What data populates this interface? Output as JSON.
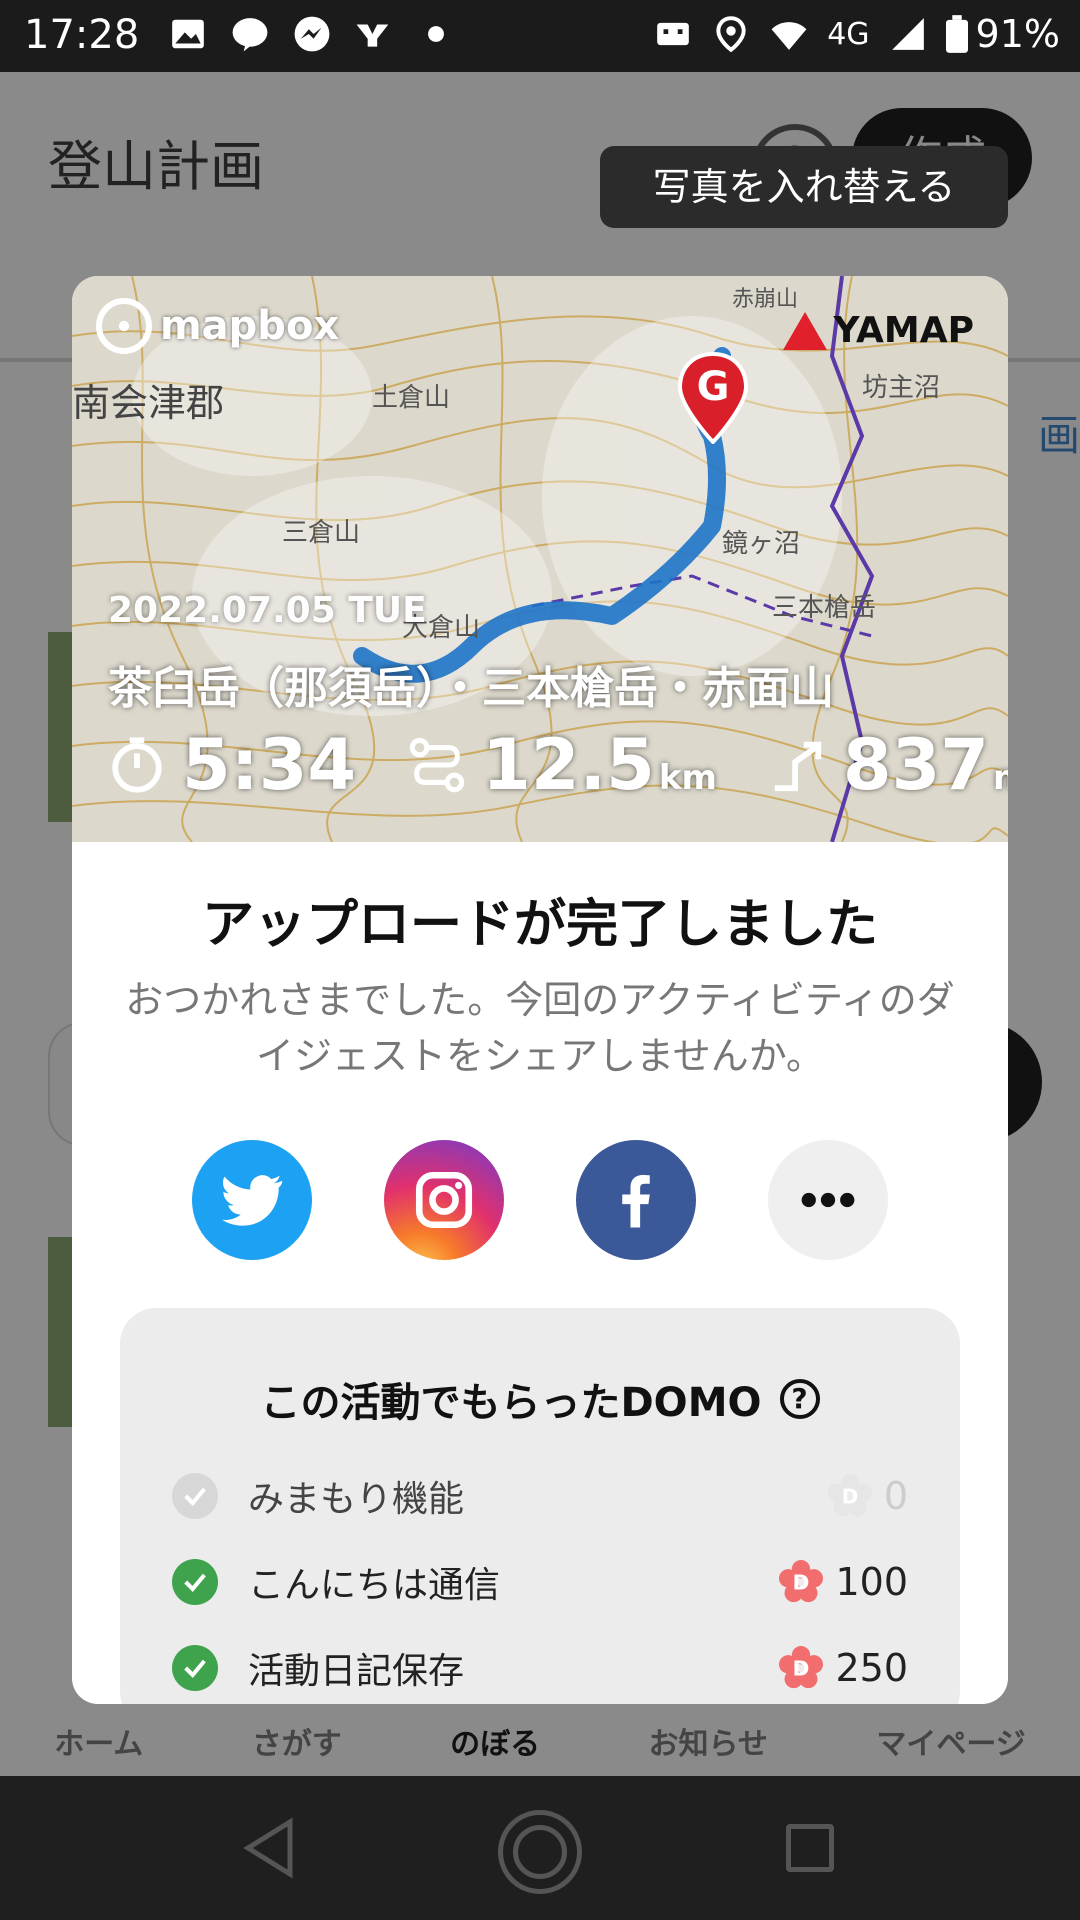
{
  "status": {
    "time": "17:28",
    "network": "4G",
    "battery": "91%"
  },
  "app": {
    "title": "登山計画",
    "create_label": "作成",
    "help_label": "?",
    "edge_text": "画",
    "snackbar": "写真を入れ替える"
  },
  "tabs": [
    {
      "label": "ホーム"
    },
    {
      "label": "さがす"
    },
    {
      "label": "のぼる"
    },
    {
      "label": "お知らせ"
    },
    {
      "label": "マイページ"
    }
  ],
  "modal": {
    "map": {
      "provider": "mapbox",
      "brand": "YAMAP",
      "goal_marker": "G",
      "date": "2022.07.05 TUE",
      "route_title": "茶臼岳（那須岳）・三本槍岳・赤面山",
      "place_labels": [
        "南会津郡",
        "土倉山",
        "三倉山",
        "大倉山",
        "鏡ヶ沼",
        "三本槍岳",
        "坊主沼",
        "赤崩山"
      ],
      "stats": {
        "time": "5:34",
        "distance": "12.5",
        "distance_unit": "km",
        "elevation": "837",
        "elevation_unit": "m"
      }
    },
    "heading": "アップロードが完了しました",
    "subtext": "おつかれさまでした。今回のアクティビティのダイジェストをシェアしませんか。",
    "share": [
      {
        "name": "twitter",
        "color": "#1da1f2"
      },
      {
        "name": "instagram",
        "color": "#e1306c"
      },
      {
        "name": "facebook",
        "color": "#3b5998"
      },
      {
        "name": "more",
        "color": "#efefef"
      }
    ],
    "domo": {
      "title": "この活動でもらったDOMO",
      "help_label": "?",
      "rows": [
        {
          "label": "みまもり機能",
          "points": "0",
          "checked": false
        },
        {
          "label": "こんにちは通信",
          "points": "100",
          "checked": true
        },
        {
          "label": "活動日記保存",
          "points": "250",
          "checked": true
        }
      ]
    }
  },
  "colors": {
    "check_green": "#3fa34d",
    "route_blue": "#1e73c8",
    "goal_red": "#d9202a",
    "domo_pink": "#f26d6d"
  }
}
